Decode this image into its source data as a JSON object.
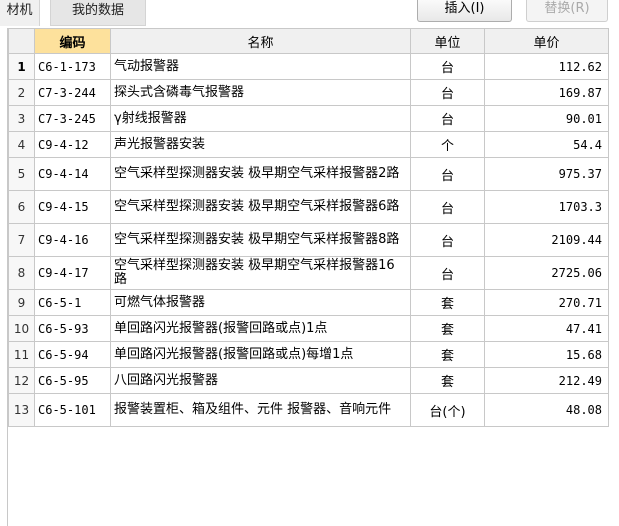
{
  "tabs": [
    "材机",
    "我的数据"
  ],
  "buttons": {
    "insert": "插入(I)",
    "replace": "替换(R)"
  },
  "columns": {
    "code": "编码",
    "name": "名称",
    "unit": "单位",
    "price": "单价"
  },
  "rows": [
    {
      "num": "1",
      "code": "C6-1-173",
      "name": "气动报警器",
      "unit": "台",
      "price": "112.62",
      "tall": false
    },
    {
      "num": "2",
      "code": "C7-3-244",
      "name": "探头式含磷毒气报警器",
      "unit": "台",
      "price": "169.87",
      "tall": false
    },
    {
      "num": "3",
      "code": "C7-3-245",
      "name": "γ射线报警器",
      "unit": "台",
      "price": "90.01",
      "tall": false
    },
    {
      "num": "4",
      "code": "C9-4-12",
      "name": "声光报警器安装",
      "unit": "个",
      "price": "54.4",
      "tall": false
    },
    {
      "num": "5",
      "code": "C9-4-14",
      "name": "空气采样型探测器安装 极早期空气采样报警器2路",
      "unit": "台",
      "price": "975.37",
      "tall": true
    },
    {
      "num": "6",
      "code": "C9-4-15",
      "name": "空气采样型探测器安装 极早期空气采样报警器6路",
      "unit": "台",
      "price": "1703.3",
      "tall": true
    },
    {
      "num": "7",
      "code": "C9-4-16",
      "name": "空气采样型探测器安装 极早期空气采样报警器8路",
      "unit": "台",
      "price": "2109.44",
      "tall": true
    },
    {
      "num": "8",
      "code": "C9-4-17",
      "name": "空气采样型探测器安装 极早期空气采样报警器16路",
      "unit": "台",
      "price": "2725.06",
      "tall": true
    },
    {
      "num": "9",
      "code": "C6-5-1",
      "name": "可燃气体报警器",
      "unit": "套",
      "price": "270.71",
      "tall": false
    },
    {
      "num": "10",
      "code": "C6-5-93",
      "name": "单回路闪光报警器(报警回路或点)1点",
      "unit": "套",
      "price": "47.41",
      "tall": false
    },
    {
      "num": "11",
      "code": "C6-5-94",
      "name": "单回路闪光报警器(报警回路或点)每增1点",
      "unit": "套",
      "price": "15.68",
      "tall": false
    },
    {
      "num": "12",
      "code": "C6-5-95",
      "name": "八回路闪光报警器",
      "unit": "套",
      "price": "212.49",
      "tall": false
    },
    {
      "num": "13",
      "code": "C6-5-101",
      "name": "报警装置柜、箱及组件、元件 报警器、音响元件",
      "unit": "台(个)",
      "price": "48.08",
      "tall": true
    }
  ]
}
